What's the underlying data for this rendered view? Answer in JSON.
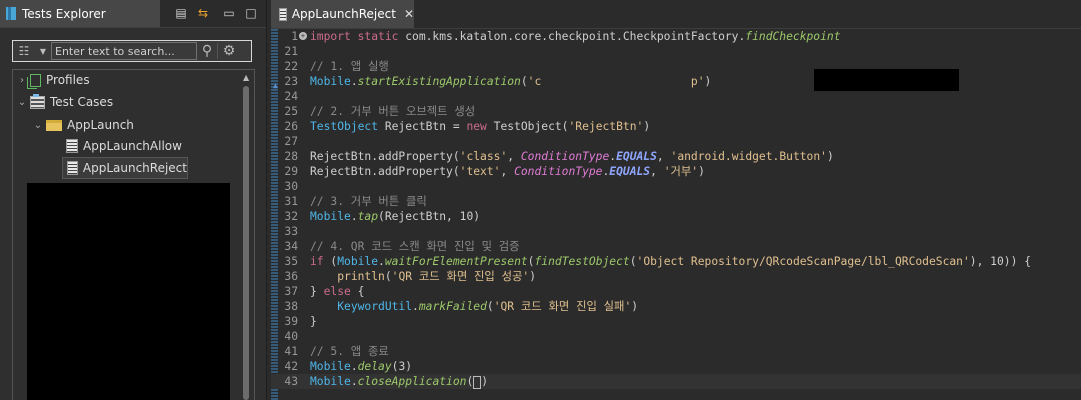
{
  "tests_explorer": {
    "title": "Tests Explorer",
    "search_placeholder": "Enter text to search...",
    "tree": [
      {
        "label": "Profiles",
        "expanded": false,
        "icon": "profiles-icon"
      },
      {
        "label": "Test Cases",
        "expanded": true,
        "icon": "test-cases-icon"
      },
      {
        "label": "AppLaunch",
        "expanded": true,
        "icon": "folder-icon"
      },
      {
        "label": "AppLaunchAllow",
        "icon": "test-case-icon"
      },
      {
        "label": "AppLaunchReject",
        "icon": "test-case-icon",
        "selected": true
      }
    ]
  },
  "editor": {
    "tab_title": "AppLaunchReject",
    "lines": [
      {
        "n": "1",
        "tokens": [
          [
            "k",
            "import static "
          ],
          [
            "m",
            "com.kms.katalon.core.checkpoint.CheckpointFactory."
          ],
          [
            "mi",
            "findCheckpoint"
          ]
        ]
      },
      {
        "n": "21",
        "tokens": []
      },
      {
        "n": "22",
        "tokens": [
          [
            "c",
            "// 1. 앱 실행"
          ]
        ]
      },
      {
        "n": "23",
        "tokens": [
          [
            "t",
            "Mobile"
          ],
          [
            "m",
            "."
          ],
          [
            "mi",
            "startExistingApplication"
          ],
          [
            "m",
            "("
          ],
          [
            "s",
            "'c"
          ],
          [
            "s",
            "                      p'"
          ],
          [
            "m",
            ")"
          ]
        ]
      },
      {
        "n": "24",
        "tokens": []
      },
      {
        "n": "25",
        "tokens": [
          [
            "c",
            "// 2. 거부 버튼 오브젝트 생성"
          ]
        ]
      },
      {
        "n": "26",
        "tokens": [
          [
            "t",
            "TestObject"
          ],
          [
            "m",
            " RejectBtn = "
          ],
          [
            "k",
            "new "
          ],
          [
            "m",
            "TestObject("
          ],
          [
            "s",
            "'RejectBtn'"
          ],
          [
            "m",
            ")"
          ]
        ]
      },
      {
        "n": "27",
        "tokens": []
      },
      {
        "n": "28",
        "tokens": [
          [
            "m",
            "RejectBtn.addProperty("
          ],
          [
            "s",
            "'class'"
          ],
          [
            "m",
            ", "
          ],
          [
            "ct",
            "ConditionType"
          ],
          [
            "m",
            "."
          ],
          [
            "cf",
            "EQUALS"
          ],
          [
            "m",
            ", "
          ],
          [
            "s",
            "'android.widget.Button'"
          ],
          [
            "m",
            ")"
          ]
        ]
      },
      {
        "n": "29",
        "tokens": [
          [
            "m",
            "RejectBtn.addProperty("
          ],
          [
            "s",
            "'text'"
          ],
          [
            "m",
            ", "
          ],
          [
            "ct",
            "ConditionType"
          ],
          [
            "m",
            "."
          ],
          [
            "cf",
            "EQUALS"
          ],
          [
            "m",
            ", "
          ],
          [
            "s",
            "'거부'"
          ],
          [
            "m",
            ")"
          ]
        ]
      },
      {
        "n": "30",
        "tokens": []
      },
      {
        "n": "31",
        "tokens": [
          [
            "c",
            "// 3. 거부 버튼 클릭"
          ]
        ]
      },
      {
        "n": "32",
        "tokens": [
          [
            "t",
            "Mobile"
          ],
          [
            "m",
            "."
          ],
          [
            "mi",
            "tap"
          ],
          [
            "m",
            "(RejectBtn, 10)"
          ]
        ]
      },
      {
        "n": "33",
        "tokens": []
      },
      {
        "n": "34",
        "tokens": [
          [
            "c",
            "// 4. QR 코드 스캔 화면 진입 및 검증"
          ]
        ]
      },
      {
        "n": "35",
        "tokens": [
          [
            "k",
            "if "
          ],
          [
            "m",
            "("
          ],
          [
            "t",
            "Mobile"
          ],
          [
            "m",
            "."
          ],
          [
            "mi",
            "waitForElementPresent"
          ],
          [
            "m",
            "("
          ],
          [
            "mi",
            "findTestObject"
          ],
          [
            "m",
            "("
          ],
          [
            "s",
            "'Object Repository/QRcodeScanPage/lbl_QRCodeScan'"
          ],
          [
            "m",
            "), 10)) {"
          ]
        ]
      },
      {
        "n": "36",
        "tokens": [
          [
            "m",
            "    "
          ],
          [
            "s",
            "println"
          ],
          [
            "m",
            "("
          ],
          [
            "s",
            "'QR 코드 화면 진입 성공'"
          ],
          [
            "m",
            ")"
          ]
        ]
      },
      {
        "n": "37",
        "tokens": [
          [
            "m",
            "} "
          ],
          [
            "k",
            "else "
          ],
          [
            "m",
            "{"
          ]
        ]
      },
      {
        "n": "38",
        "tokens": [
          [
            "m",
            "    "
          ],
          [
            "t",
            "KeywordUtil"
          ],
          [
            "m",
            "."
          ],
          [
            "mi",
            "markFailed"
          ],
          [
            "m",
            "("
          ],
          [
            "s",
            "'QR 코드 화면 진입 실패'"
          ],
          [
            "m",
            ")"
          ]
        ]
      },
      {
        "n": "39",
        "tokens": [
          [
            "m",
            "}"
          ]
        ]
      },
      {
        "n": "40",
        "tokens": []
      },
      {
        "n": "41",
        "tokens": [
          [
            "c",
            "// 5. 앱 종료"
          ]
        ]
      },
      {
        "n": "42",
        "tokens": [
          [
            "t",
            "Mobile"
          ],
          [
            "m",
            "."
          ],
          [
            "mi",
            "delay"
          ],
          [
            "m",
            "(3)"
          ]
        ]
      },
      {
        "n": "43",
        "tokens": [
          [
            "t",
            "Mobile"
          ],
          [
            "m",
            "."
          ],
          [
            "mi",
            "closeApplication"
          ],
          [
            "m",
            "("
          ],
          [
            "cur",
            ""
          ],
          [
            "m",
            ")"
          ]
        ]
      }
    ]
  }
}
